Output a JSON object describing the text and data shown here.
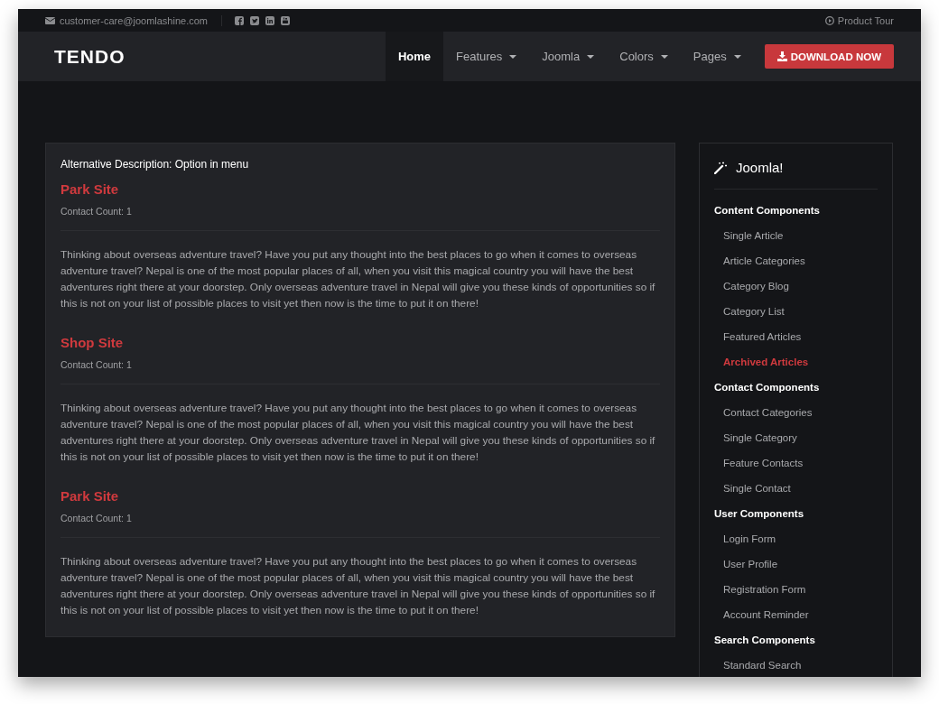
{
  "topbar": {
    "email": "customer-care@joomlashine.com",
    "social": [
      {
        "kind": "facebook"
      },
      {
        "kind": "twitter"
      },
      {
        "kind": "linkedin"
      },
      {
        "kind": "youtube"
      }
    ],
    "tour": "Product Tour"
  },
  "nav": {
    "logo": "TENDO",
    "items": [
      {
        "label": "Home",
        "selected": true,
        "dropdown": false
      },
      {
        "label": "Features",
        "selected": false,
        "dropdown": true
      },
      {
        "label": "Joomla",
        "selected": false,
        "dropdown": true
      },
      {
        "label": "Colors",
        "selected": false,
        "dropdown": true
      },
      {
        "label": "Pages",
        "selected": false,
        "dropdown": true
      }
    ],
    "cta": "DOWNLOAD NOW"
  },
  "main": {
    "heading": "Alternative Description: Option in menu",
    "contacts": [
      {
        "title": "Park Site",
        "count": "Contact Count: 1",
        "text": "Thinking about overseas adventure travel? Have you put any thought into the best places to go when it comes to overseas adventure travel? Nepal is one of the most popular places of all, when you visit this magical country you will have the best adventures right there at your doorstep. Only overseas adventure travel in Nepal will give you these kinds of opportunities so if this is not on your list of possible places to visit yet then now is the time to put it on there!"
      },
      {
        "title": "Shop Site",
        "count": "Contact Count: 1",
        "text": "Thinking about overseas adventure travel? Have you put any thought into the best places to go when it comes to overseas adventure travel? Nepal is one of the most popular places of all, when you visit this magical country you will have the best adventures right there at your doorstep. Only overseas adventure travel in Nepal will give you these kinds of opportunities so if this is not on your list of possible places to visit yet then now is the time to put it on there!"
      },
      {
        "title": "Park Site",
        "count": "Contact Count: 1",
        "text": "Thinking about overseas adventure travel? Have you put any thought into the best places to go when it comes to overseas adventure travel? Nepal is one of the most popular places of all, when you visit this magical country you will have the best adventures right there at your doorstep. Only overseas adventure travel in Nepal will give you these kinds of opportunities so if this is not on your list of possible places to visit yet then now is the time to put it on there!"
      }
    ]
  },
  "sidebar": {
    "title": "Joomla!",
    "groups": [
      {
        "heading": "Content Components",
        "items": [
          {
            "label": "Single Article",
            "selected": false
          },
          {
            "label": "Article Categories",
            "selected": false
          },
          {
            "label": "Category Blog",
            "selected": false
          },
          {
            "label": "Category List",
            "selected": false
          },
          {
            "label": "Featured Articles",
            "selected": false
          },
          {
            "label": "Archived Articles",
            "selected": true
          }
        ]
      },
      {
        "heading": "Contact Components",
        "items": [
          {
            "label": "Contact Categories",
            "selected": false
          },
          {
            "label": "Single Category",
            "selected": false
          },
          {
            "label": "Feature Contacts",
            "selected": false
          },
          {
            "label": "Single Contact",
            "selected": false
          }
        ]
      },
      {
        "heading": "User Components",
        "items": [
          {
            "label": "Login Form",
            "selected": false
          },
          {
            "label": "User Profile",
            "selected": false
          },
          {
            "label": "Registration Form",
            "selected": false
          },
          {
            "label": "Account Reminder",
            "selected": false
          }
        ]
      },
      {
        "heading": "Search Components",
        "items": [
          {
            "label": "Standard Search",
            "selected": false
          }
        ]
      }
    ]
  }
}
